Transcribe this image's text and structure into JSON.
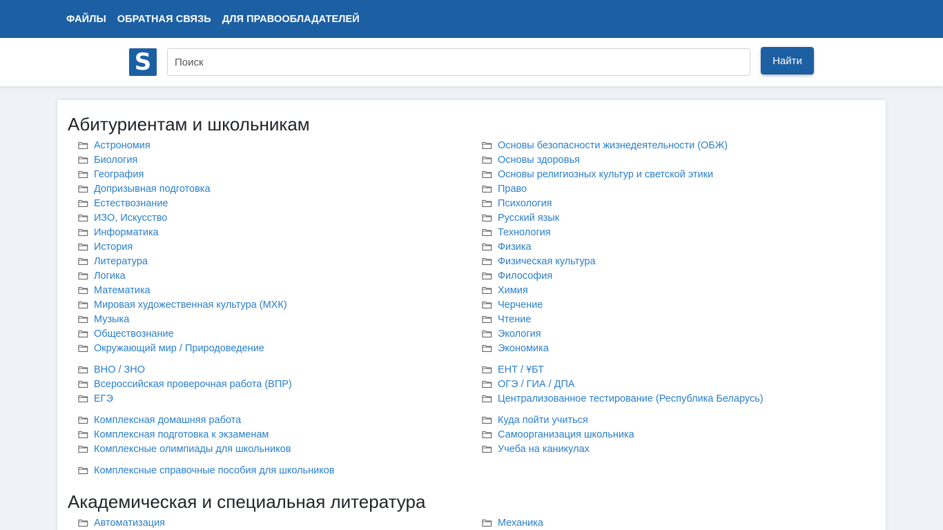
{
  "nav": {
    "items": [
      "ФАЙЛЫ",
      "ОБРАТНАЯ СВЯЗЬ",
      "ДЛЯ ПРАВООБЛАДАТЕЛЕЙ"
    ]
  },
  "header": {
    "logo_letter": "S",
    "search_placeholder": "Поиск",
    "search_button": "Найти"
  },
  "colors": {
    "brand": "#1c5fa3",
    "link": "#2a7fc9",
    "background": "#f0f2f7"
  },
  "sections": [
    {
      "title": "Абитуриентам и школьникам",
      "groups": [
        {
          "left": [
            "Астрономия",
            "Биология",
            "География",
            "Допризывная подготовка",
            "Естествознание",
            "ИЗО, Искусство",
            "Информатика",
            "История",
            "Литература",
            "Логика",
            "Математика",
            "Мировая художественная культура (МХК)",
            "Музыка",
            "Обществознание",
            "Окружающий мир / Природоведение"
          ],
          "right": [
            "Основы безопасности жизнедеятельности (ОБЖ)",
            "Основы здоровья",
            "Основы религиозных культур и светской этики",
            "Право",
            "Психология",
            "Русский язык",
            "Технология",
            "Физика",
            "Физическая культура",
            "Философия",
            "Химия",
            "Черчение",
            "Чтение",
            "Экология",
            "Экономика"
          ]
        },
        {
          "left": [
            "ВНО / ЗНО",
            "Всероссийская проверочная работа (ВПР)",
            "ЕГЭ"
          ],
          "right": [
            "ЕНТ / ҰБТ",
            "ОГЭ / ГИА / ДПА",
            "Централизованное тестирование (Республика Беларусь)"
          ]
        },
        {
          "left": [
            "Комплексная домашняя работа",
            "Комплексная подготовка к экзаменам",
            "Комплексные олимпиады для школьников"
          ],
          "right": [
            "Куда пойти учиться",
            "Самоорганизация школьника",
            "Учеба на каникулах"
          ]
        },
        {
          "left": [
            "Комплексные справочные пособия для школьников"
          ],
          "right": []
        }
      ]
    },
    {
      "title": "Академическая и специальная литература",
      "groups": [
        {
          "left": [
            "Автоматизация"
          ],
          "right": [
            "Механика"
          ]
        }
      ]
    }
  ]
}
